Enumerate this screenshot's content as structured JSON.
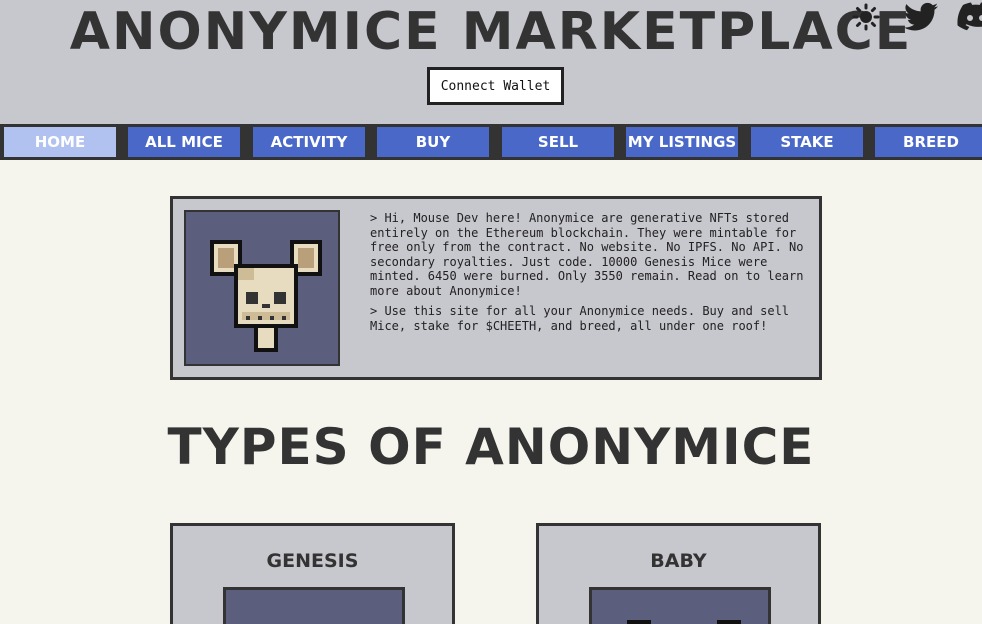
{
  "header": {
    "title": "ANONYMICE MARKETPLACE",
    "connect_wallet": "Connect Wallet",
    "icons": [
      "sun-icon",
      "twitter-icon",
      "discord-icon"
    ]
  },
  "nav": {
    "items": [
      {
        "label": "Home",
        "active": true
      },
      {
        "label": "All Mice",
        "active": false
      },
      {
        "label": "Activity",
        "active": false
      },
      {
        "label": "Buy",
        "active": false
      },
      {
        "label": "Sell",
        "active": false
      },
      {
        "label": "My Listings",
        "active": false
      },
      {
        "label": "Stake",
        "active": false
      },
      {
        "label": "Breed",
        "active": false
      }
    ]
  },
  "intro": {
    "paragraph1": "> Hi, Mouse Dev here! Anonymice are generative NFTs stored entirely on the Ethereum blockchain. They were mintable for free only from the contract. No website. No IPFS. No API. No secondary royalties. Just code. 10000 Genesis Mice were minted. 6450 were burned. Only 3550 remain. Read on to learn more about Anonymice!",
    "paragraph2": "> Use this site for all your Anonymice needs. Buy and sell Mice, stake for $CHEETH, and breed, all under one roof!"
  },
  "types": {
    "title": "TYPES OF ANONYMICE",
    "cards": [
      {
        "label": "Genesis"
      },
      {
        "label": "Baby"
      }
    ]
  },
  "colors": {
    "header_bg": "#c7c7ce",
    "nav_bg": "#333333",
    "nav_item": "#4a68c8",
    "nav_active": "#b2c2f0",
    "page_bg": "#f5f5ee",
    "image_bg": "#5b5e7c"
  }
}
